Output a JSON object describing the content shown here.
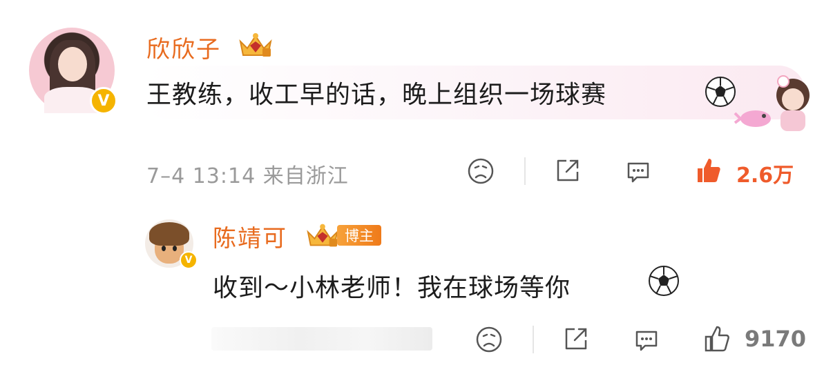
{
  "main_comment": {
    "username": "欣欣子",
    "text": "王教练，收工早的话，晚上组织一场球赛",
    "emoji": "soccer-ball",
    "meta": "7–4 13:14 来自浙江",
    "like_count": "2.6万",
    "verified_badge": "V",
    "accent_color": "#e86b1f",
    "like_color": "#ef5b2b"
  },
  "reply": {
    "username": "陈靖可",
    "host_label": "博主",
    "text": "收到～小林老师！我在球场等你",
    "emoji": "soccer-ball",
    "verified_badge": "V",
    "like_count": "9170"
  },
  "icons": {
    "dislike": "sad-face-icon",
    "share": "share-icon",
    "comment": "comment-icon",
    "like": "thumbs-up-icon"
  }
}
